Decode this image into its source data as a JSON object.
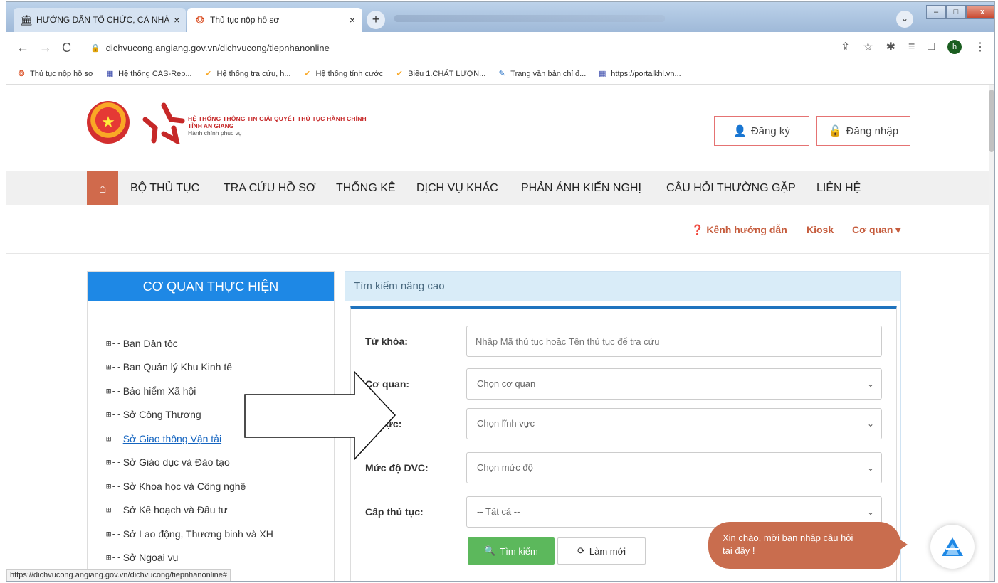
{
  "browser": {
    "tabs": [
      {
        "label": "HƯỚNG DẪN TỔ CHỨC, CÁ NHÂ"
      },
      {
        "label": "Thủ tục nộp hồ sơ"
      }
    ],
    "url": "dichvucong.angiang.gov.vn/dichvucong/tiepnhanonline",
    "profile_initial": "h",
    "bookmarks": [
      "Thủ tục nộp hồ sơ",
      "Hệ thống CAS-Rep...",
      "Hệ thống tra cứu, h...",
      "Hệ thống tính cước",
      "Biểu 1.CHẤT LƯỢN...",
      "Trang văn bản chỉ đ...",
      "https://portalkhl.vn..."
    ],
    "status_url": "https://dichvucong.angiang.gov.vn/dichvucong/tiepnhanonline#"
  },
  "header": {
    "logo_line1": "HỆ THỐNG THÔNG TIN GIẢI QUYẾT THỦ TỤC HÀNH CHÍNH",
    "logo_line2": "TỈNH AN GIANG",
    "logo_line3": "Hành chính phục vụ",
    "register": "Đăng ký",
    "login": "Đăng nhập"
  },
  "menu": [
    "BỘ THỦ TỤC",
    "TRA CỨU HỒ SƠ",
    "THỐNG KÊ",
    "DỊCH VỤ KHÁC",
    "PHẢN ÁNH KIẾN NGHỊ",
    "CÂU HỎI THƯỜNG GẶP",
    "LIÊN HỆ"
  ],
  "sublinks": {
    "guide": "Kênh hướng dẫn",
    "kiosk": "Kiosk",
    "agency": "Cơ quan"
  },
  "left_panel": {
    "title": "CƠ QUAN THỰC HIỆN",
    "items": [
      "Ban Dân tộc",
      "Ban Quản lý Khu Kinh tế",
      "Bảo hiểm Xã hội",
      "Sở Công Thương",
      "Sở Giao thông Vận tải",
      "Sở Giáo dục và Đào tạo",
      "Sở Khoa học và Công nghệ",
      "Sở Kế hoạch và Đầu tư",
      "Sở Lao động, Thương binh và XH",
      "Sở Ngoại vụ"
    ]
  },
  "search_form": {
    "title": "Tìm kiếm nâng cao",
    "keyword_label": "Từ khóa:",
    "keyword_placeholder": "Nhập Mã thủ tục hoặc Tên thủ tục để tra cứu",
    "agency_label": "Cơ quan:",
    "agency_value": "Chọn cơ quan",
    "field_label": "nh vực:",
    "field_value": "Chọn lĩnh vực",
    "level_label": "Mức độ DVC:",
    "level_value": "Chọn mức độ",
    "tier_label": "Cấp thủ tục:",
    "tier_value": "-- Tất cả --",
    "search_button": "Tìm kiếm",
    "reset_button": "Làm mới"
  },
  "chat": {
    "line1": "Xin chào, mời bạn nhập câu hỏi",
    "line2": "tại đây !"
  },
  "colors": {
    "accent_blue": "#1e88e5",
    "brand_orange": "#c96d4e",
    "search_green": "#5cb85c"
  }
}
